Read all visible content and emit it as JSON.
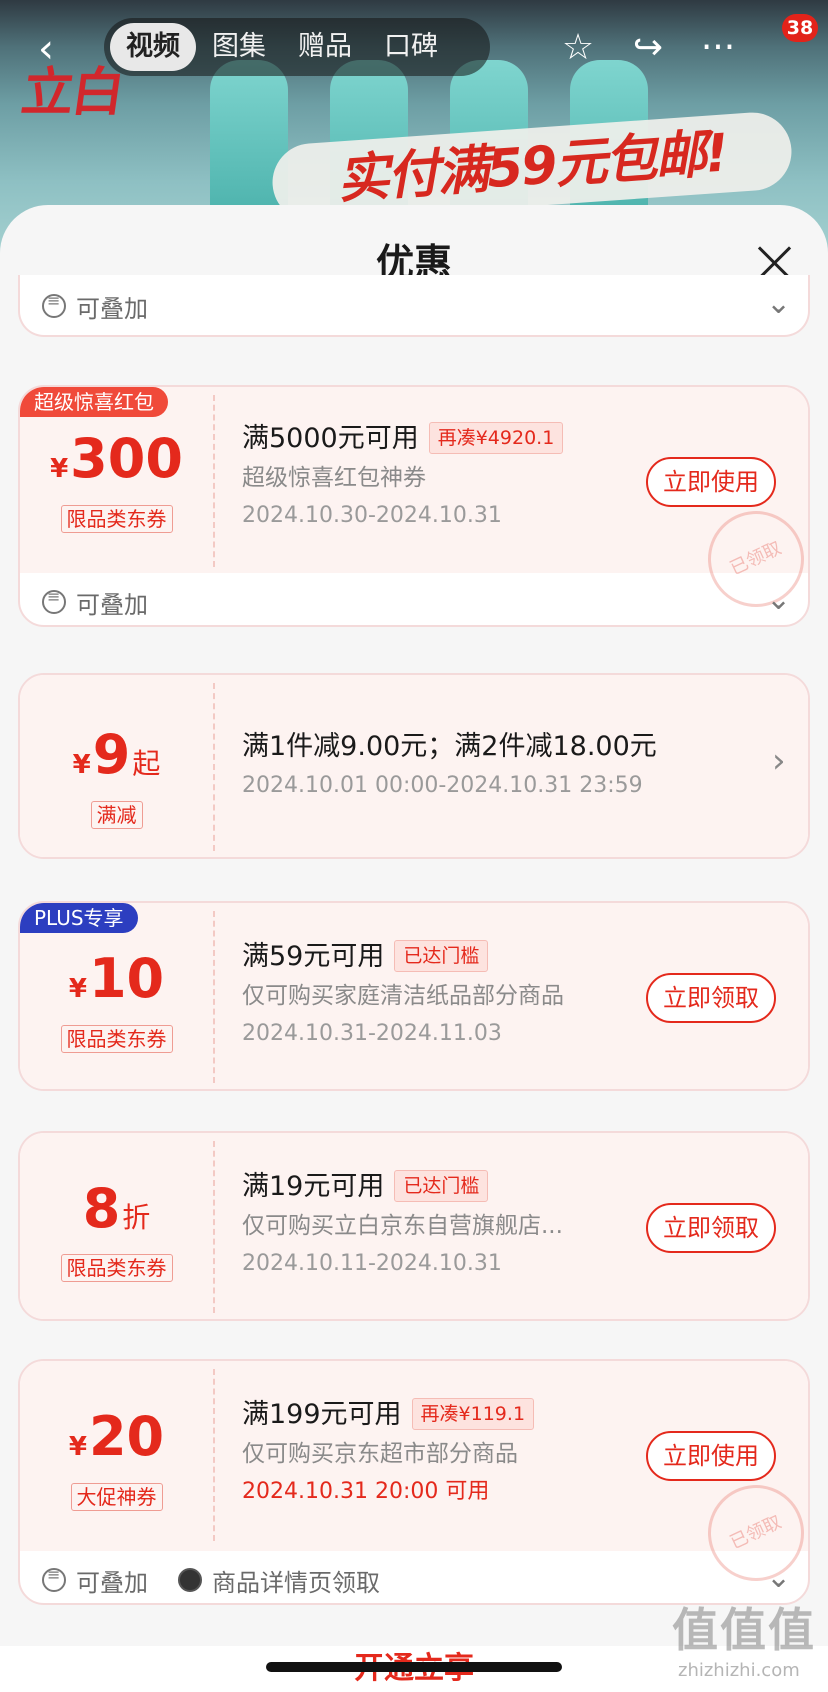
{
  "header": {
    "tabs": [
      "视频",
      "图集",
      "赠品",
      "口碑"
    ],
    "active_tab": 0,
    "badge_count": "38",
    "hero_logo": "立白",
    "hero_slogan": "实付满59元包邮!"
  },
  "sheet": {
    "title": "优惠",
    "top_foot": {
      "label": "可叠加"
    }
  },
  "coupons": [
    {
      "corner": "超级惊喜红包",
      "currency": "¥",
      "amount": "300",
      "tag": "限品类东券",
      "condition": "满5000元可用",
      "pill": "再凑¥4920.1",
      "desc": "超级惊喜红包神券",
      "date": "2024.10.30-2024.10.31",
      "button": "立即使用",
      "stamp": "已领取",
      "foot": "可叠加"
    },
    {
      "currency": "¥",
      "amount": "9",
      "suffix": "起",
      "tag": "满减",
      "condition": "满1件减9.00元；满2件减18.00元",
      "date": "2024.10.01 00:00-2024.10.31 23:59"
    },
    {
      "corner": "PLUS专享",
      "currency": "¥",
      "amount": "10",
      "tag": "限品类东券",
      "condition": "满59元可用",
      "pill": "已达门槛",
      "desc": "仅可购买家庭清洁纸品部分商品",
      "date": "2024.10.31-2024.11.03",
      "button": "立即领取"
    },
    {
      "amount": "8",
      "suffix": "折",
      "tag": "限品类东券",
      "condition": "满19元可用",
      "pill": "已达门槛",
      "desc": "仅可购买立白京东自营旗舰店...",
      "date": "2024.10.11-2024.10.31",
      "button": "立即领取"
    },
    {
      "currency": "¥",
      "amount": "20",
      "tag": "大促神券",
      "condition": "满199元可用",
      "pill": "再凑¥119.1",
      "desc": "仅可购买京东超市部分商品",
      "date": "2024.10.31 20:00 可用",
      "button": "立即使用",
      "stamp": "已领取",
      "foot": "可叠加",
      "foot2": "商品详情页领取"
    }
  ],
  "bottom": {
    "label": "开通立享"
  },
  "watermark": {
    "logo": "值值值",
    "site": "zhizhizhi.com"
  },
  "colors": {
    "accent": "#e4291c",
    "plus": "#2c3ec0"
  }
}
